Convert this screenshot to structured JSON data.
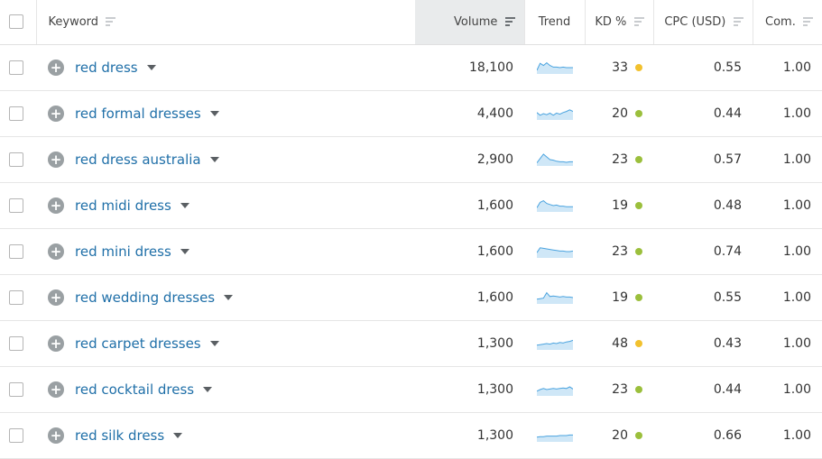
{
  "header": {
    "keyword": "Keyword",
    "volume": "Volume",
    "trend": "Trend",
    "kd": "KD %",
    "cpc": "CPC (USD)",
    "com": "Com."
  },
  "icons": {
    "add": "plus-circle-icon",
    "expand": "caret-down-icon",
    "sort": "sort-icon",
    "trend": "sparkline"
  },
  "colors": {
    "link": "#1f6fa8",
    "kd_easy": "#9bbf3c",
    "kd_medium": "#f2c12e",
    "sparkline_stroke": "#4aa3df",
    "sparkline_fill": "#cfe7f7",
    "sorted_header_bg": "#e9ebec"
  },
  "rows": [
    {
      "keyword": "red dress",
      "volume": "18,100",
      "trend": [
        0.25,
        0.9,
        0.7,
        0.95,
        0.7,
        0.55,
        0.55,
        0.5,
        0.55,
        0.5,
        0.5,
        0.5
      ],
      "kd": "33",
      "kd_color": "#f2c12e",
      "cpc": "0.55",
      "com": "1.00"
    },
    {
      "keyword": "red formal dresses",
      "volume": "4,400",
      "trend": [
        0.6,
        0.35,
        0.5,
        0.4,
        0.55,
        0.35,
        0.55,
        0.45,
        0.6,
        0.7,
        0.85,
        0.7
      ],
      "kd": "20",
      "kd_color": "#9bbf3c",
      "cpc": "0.44",
      "com": "1.00"
    },
    {
      "keyword": "red dress australia",
      "volume": "2,900",
      "trend": [
        0.2,
        0.6,
        1.0,
        0.75,
        0.5,
        0.45,
        0.35,
        0.3,
        0.3,
        0.25,
        0.3,
        0.3
      ],
      "kd": "23",
      "kd_color": "#9bbf3c",
      "cpc": "0.57",
      "com": "1.00"
    },
    {
      "keyword": "red midi dress",
      "volume": "1,600",
      "trend": [
        0.3,
        0.8,
        0.95,
        0.7,
        0.6,
        0.5,
        0.55,
        0.45,
        0.45,
        0.4,
        0.4,
        0.4
      ],
      "kd": "19",
      "kd_color": "#9bbf3c",
      "cpc": "0.48",
      "com": "1.00"
    },
    {
      "keyword": "red mini dress",
      "volume": "1,600",
      "trend": [
        0.4,
        0.85,
        0.8,
        0.75,
        0.7,
        0.65,
        0.6,
        0.55,
        0.55,
        0.5,
        0.5,
        0.55
      ],
      "kd": "23",
      "kd_color": "#9bbf3c",
      "cpc": "0.74",
      "com": "1.00"
    },
    {
      "keyword": "red wedding dresses",
      "volume": "1,600",
      "trend": [
        0.35,
        0.4,
        0.45,
        0.95,
        0.6,
        0.65,
        0.6,
        0.55,
        0.6,
        0.55,
        0.55,
        0.5
      ],
      "kd": "19",
      "kd_color": "#9bbf3c",
      "cpc": "0.55",
      "com": "1.00"
    },
    {
      "keyword": "red carpet dresses",
      "volume": "1,300",
      "trend": [
        0.35,
        0.4,
        0.45,
        0.5,
        0.45,
        0.55,
        0.5,
        0.6,
        0.55,
        0.65,
        0.7,
        0.8
      ],
      "kd": "48",
      "kd_color": "#f2c12e",
      "cpc": "0.43",
      "com": "1.00"
    },
    {
      "keyword": "red cocktail dress",
      "volume": "1,300",
      "trend": [
        0.35,
        0.5,
        0.6,
        0.5,
        0.55,
        0.6,
        0.55,
        0.6,
        0.65,
        0.6,
        0.75,
        0.55
      ],
      "kd": "23",
      "kd_color": "#9bbf3c",
      "cpc": "0.44",
      "com": "1.00"
    },
    {
      "keyword": "red silk dress",
      "volume": "1,300",
      "trend": [
        0.35,
        0.4,
        0.4,
        0.45,
        0.45,
        0.45,
        0.45,
        0.5,
        0.5,
        0.5,
        0.55,
        0.55
      ],
      "kd": "20",
      "kd_color": "#9bbf3c",
      "cpc": "0.66",
      "com": "1.00"
    }
  ]
}
